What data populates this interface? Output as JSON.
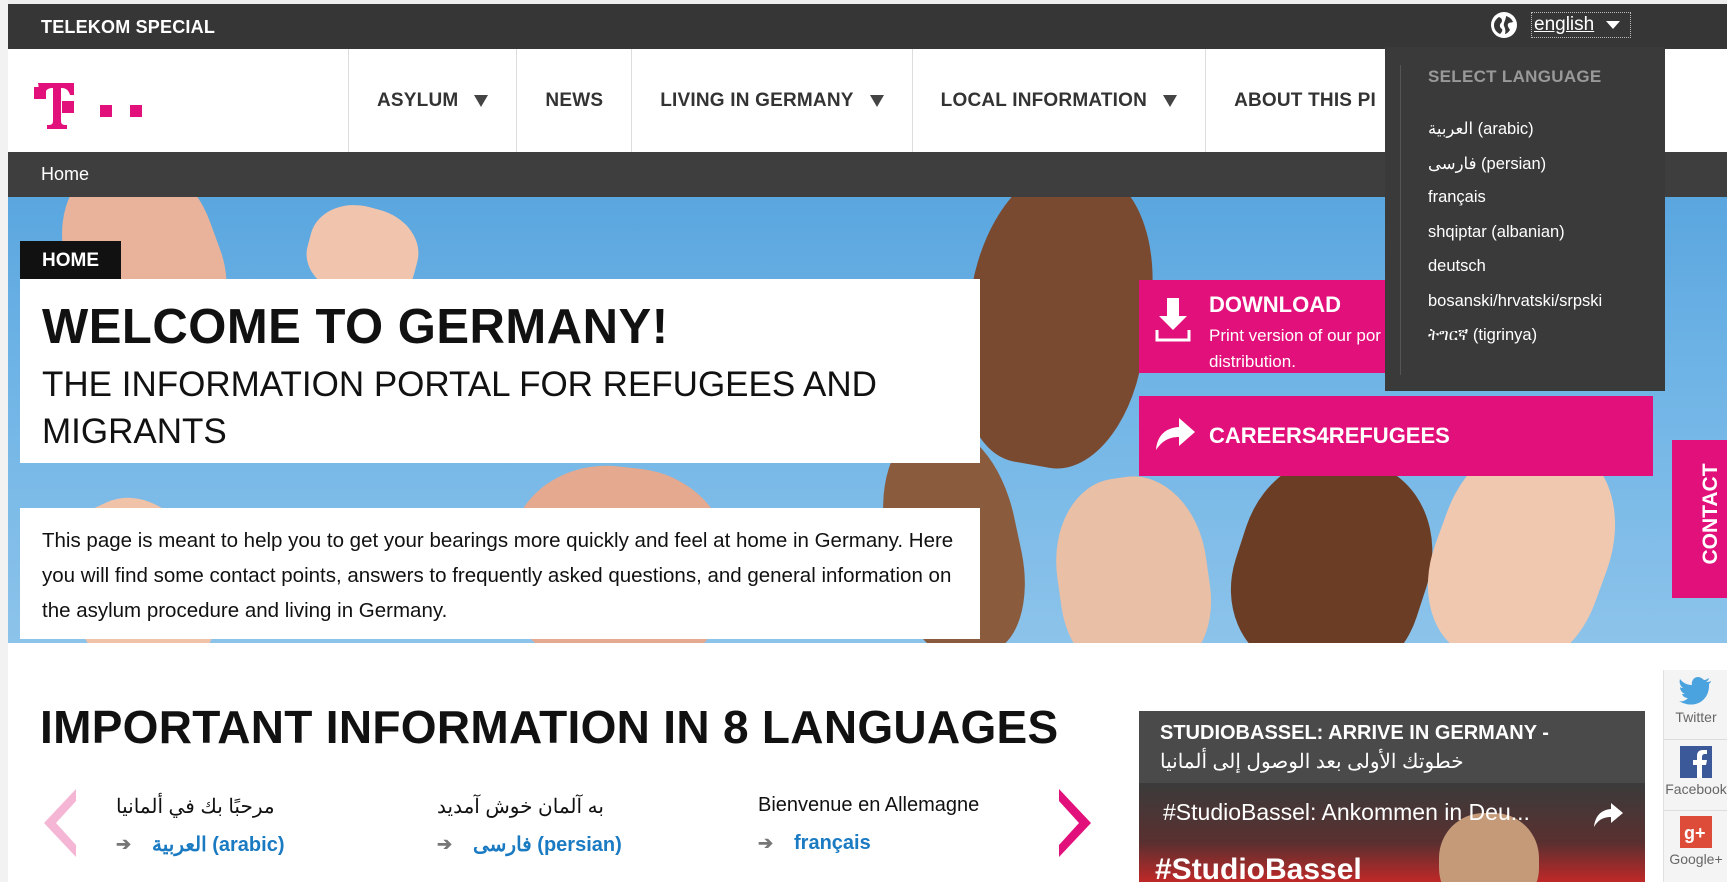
{
  "topbar": {
    "brand": "TELEKOM SPECIAL",
    "language_current": "english"
  },
  "nav": {
    "items": [
      {
        "label": "ASYLUM",
        "has_submenu": true
      },
      {
        "label": "NEWS",
        "has_submenu": false
      },
      {
        "label": "LIVING IN GERMANY",
        "has_submenu": true
      },
      {
        "label": "LOCAL INFORMATION",
        "has_submenu": true
      },
      {
        "label": "ABOUT THIS PI",
        "has_submenu": false
      }
    ]
  },
  "breadcrumb": {
    "item": "Home"
  },
  "hero": {
    "tag": "HOME",
    "title": "WELCOME TO GERMANY!",
    "subtitle": "THE INFORMATION PORTAL FOR REFUGEES AND MIGRANTS",
    "intro": "This page is meant to help you to get your bearings more quickly and feel at home in Germany. Here you will find some contact points, answers to frequently asked questions, and general information on the asylum procedure and living in Germany."
  },
  "download": {
    "title": "DOWNLOAD",
    "text": "Print version of our por distribution."
  },
  "careers": {
    "label": "CAREERS4REFUGEES"
  },
  "contact": {
    "label": "CONTACT"
  },
  "language_menu": {
    "heading": "SELECT LANGUAGE",
    "options": [
      "العربية (arabic)",
      "فارسی (persian)",
      "français",
      "shqiptar (albanian)",
      "deutsch",
      "bosanski/hrvatski/srpski",
      "ትግርኛ (tigrinya)"
    ]
  },
  "important": {
    "title": "IMPORTANT INFORMATION IN 8 LANGUAGES",
    "languages": [
      {
        "greeting": "مرحبًا بك في ألمانيا",
        "link": "العربية (arabic)"
      },
      {
        "greeting": "به آلمان خوش آمدید",
        "link": "فارسی (persian)"
      },
      {
        "greeting": "Bienvenue en Allemagne",
        "link": "français"
      }
    ]
  },
  "studiobassel": {
    "title": "STUDIOBASSEL: ARRIVE IN GERMANY -",
    "subtitle": "خطوتك الأولى بعد الوصول إلى ألمانيا",
    "video_title": "#StudioBassel: Ankommen in Deu...",
    "video_overlay": "#StudioBassel"
  },
  "social": {
    "twitter": "Twitter",
    "facebook": "Facebook",
    "google": "Google+"
  },
  "colors": {
    "magenta": "#e2107b",
    "dark_bar": "#363636",
    "link_blue": "#1a7ac2"
  }
}
